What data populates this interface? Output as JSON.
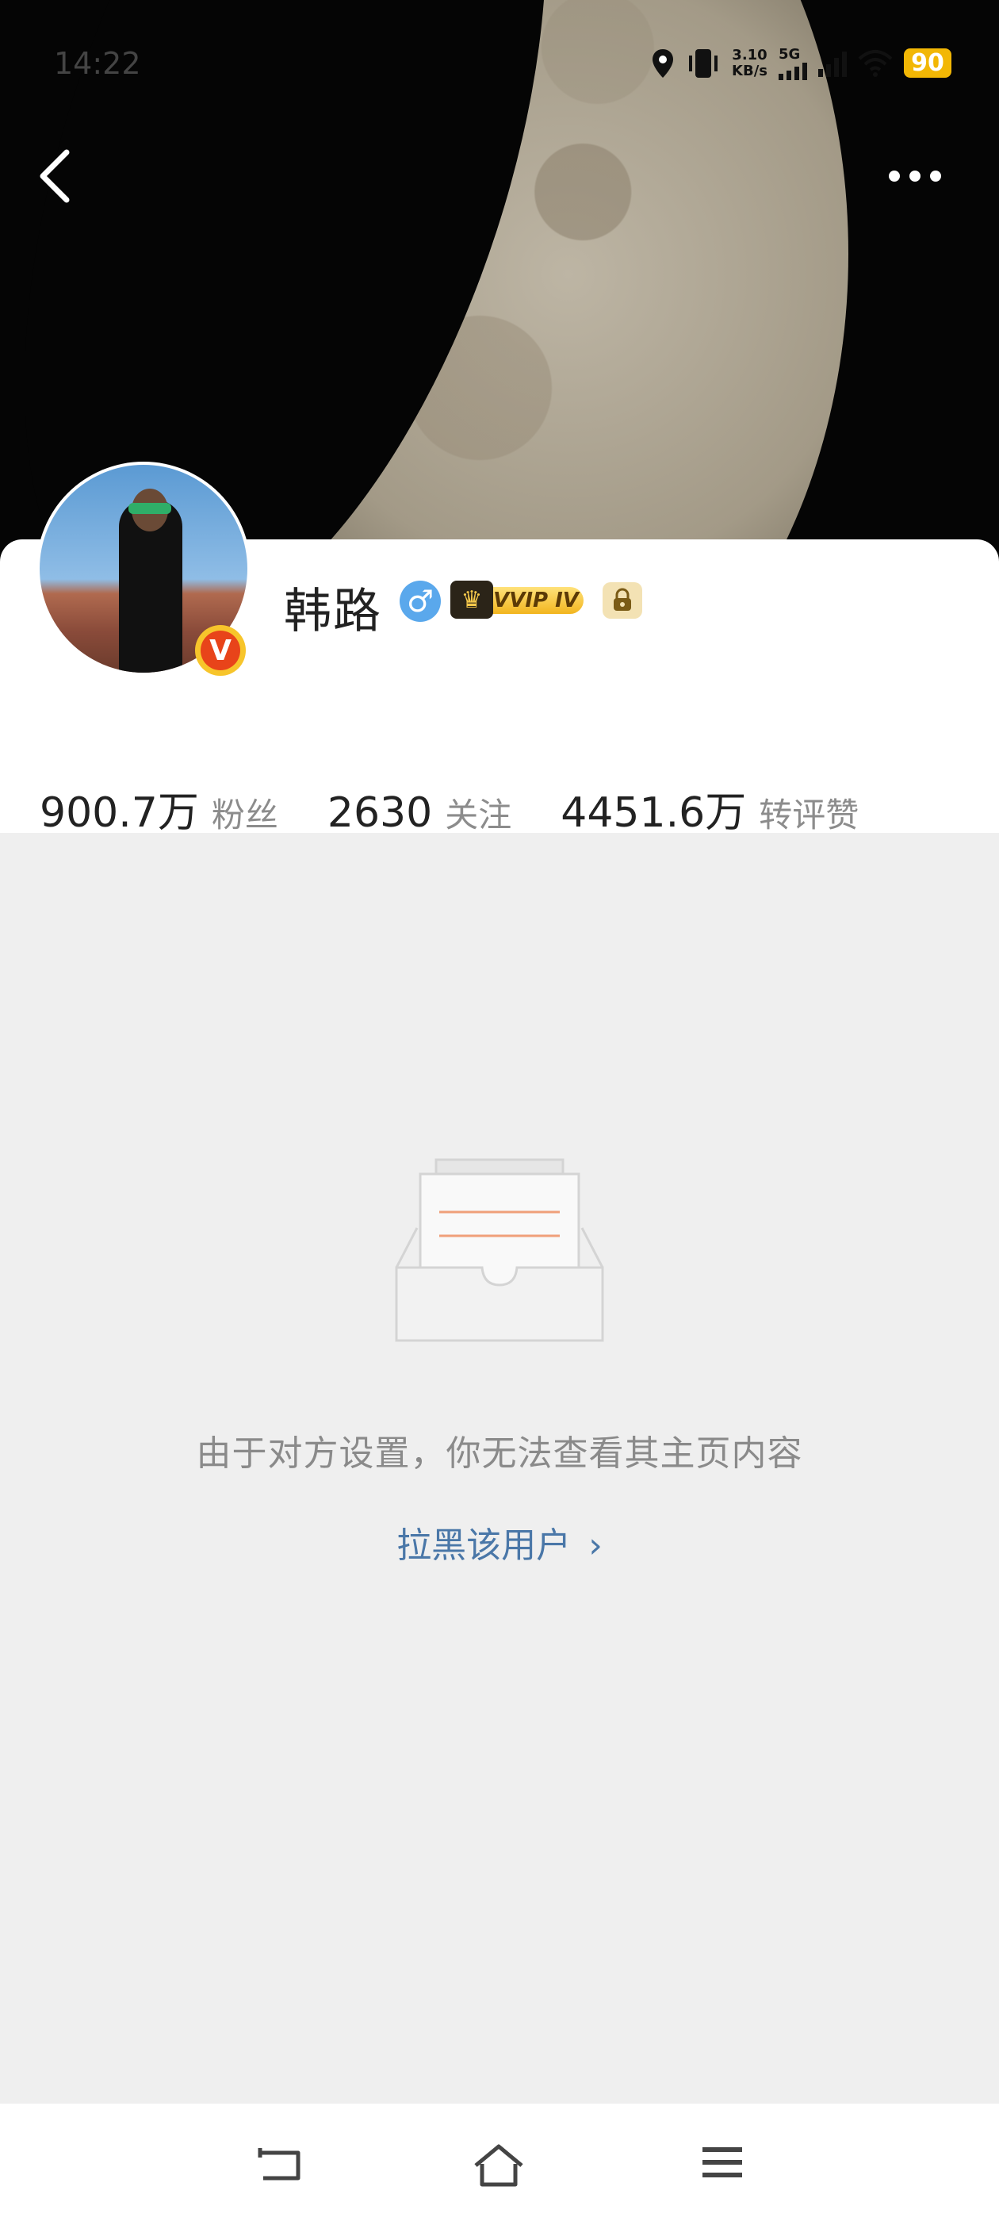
{
  "status_bar": {
    "time": "14:22",
    "speed_value": "3.10",
    "speed_unit": "KB/s",
    "network": "5G",
    "battery": "90",
    "battery_color": "#f2b705"
  },
  "toolbar": {
    "back_icon": "chevron-left-icon",
    "more_icon": "more-dots-icon"
  },
  "profile": {
    "name": "韩路",
    "gender_icon": "male-icon",
    "gender_symbol": "♂",
    "vip_badge": "VVIP IV",
    "verified_badge": "V"
  },
  "stats": [
    {
      "value": "900.7万",
      "label": "粉丝"
    },
    {
      "value": "2630",
      "label": "关注"
    },
    {
      "value": "4451.6万",
      "label": "转评赞"
    }
  ],
  "empty_state": {
    "message": "由于对方设置，你无法查看其主页内容",
    "block_link": "拉黑该用户",
    "link_chevron": "›"
  },
  "nav": {
    "back": "back-nav-icon",
    "home": "home-nav-icon",
    "menu": "menu-nav-icon"
  }
}
